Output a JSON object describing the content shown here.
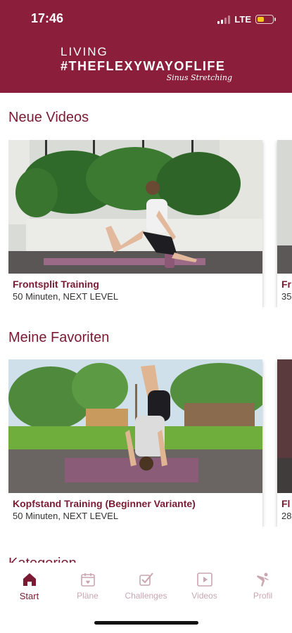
{
  "status": {
    "time": "17:46",
    "network": "LTE",
    "battery_level": 0.45
  },
  "brand": {
    "line1": "LIVING",
    "line2": "#THEFLEXYWAYOFLIFE",
    "signature": "Sinus Stretching"
  },
  "sections": {
    "new_videos": {
      "title": "Neue Videos",
      "cards": [
        {
          "title": "Frontsplit Training",
          "subtitle": "50 Minuten, NEXT LEVEL"
        },
        {
          "title": "Fr",
          "subtitle": "35"
        }
      ]
    },
    "favorites": {
      "title": "Meine Favoriten",
      "cards": [
        {
          "title": "Kopfstand Training (Beginner Variante)",
          "subtitle": "50 Minuten, NEXT LEVEL"
        },
        {
          "title": "Fl",
          "subtitle": "28"
        }
      ]
    },
    "categories": {
      "title": "Kategorien"
    }
  },
  "tabs": [
    {
      "label": "Start",
      "icon": "home-icon",
      "active": true
    },
    {
      "label": "Pläne",
      "icon": "calendar-icon",
      "active": false
    },
    {
      "label": "Challenges",
      "icon": "checkmark-icon",
      "active": false
    },
    {
      "label": "Videos",
      "icon": "play-icon",
      "active": false
    },
    {
      "label": "Profil",
      "icon": "figure-icon",
      "active": false
    }
  ],
  "colors": {
    "brand": "#8a1e3b",
    "accent_text": "#7a1a33",
    "inactive_tab": "#c9a6b0",
    "battery": "#f5c518"
  }
}
